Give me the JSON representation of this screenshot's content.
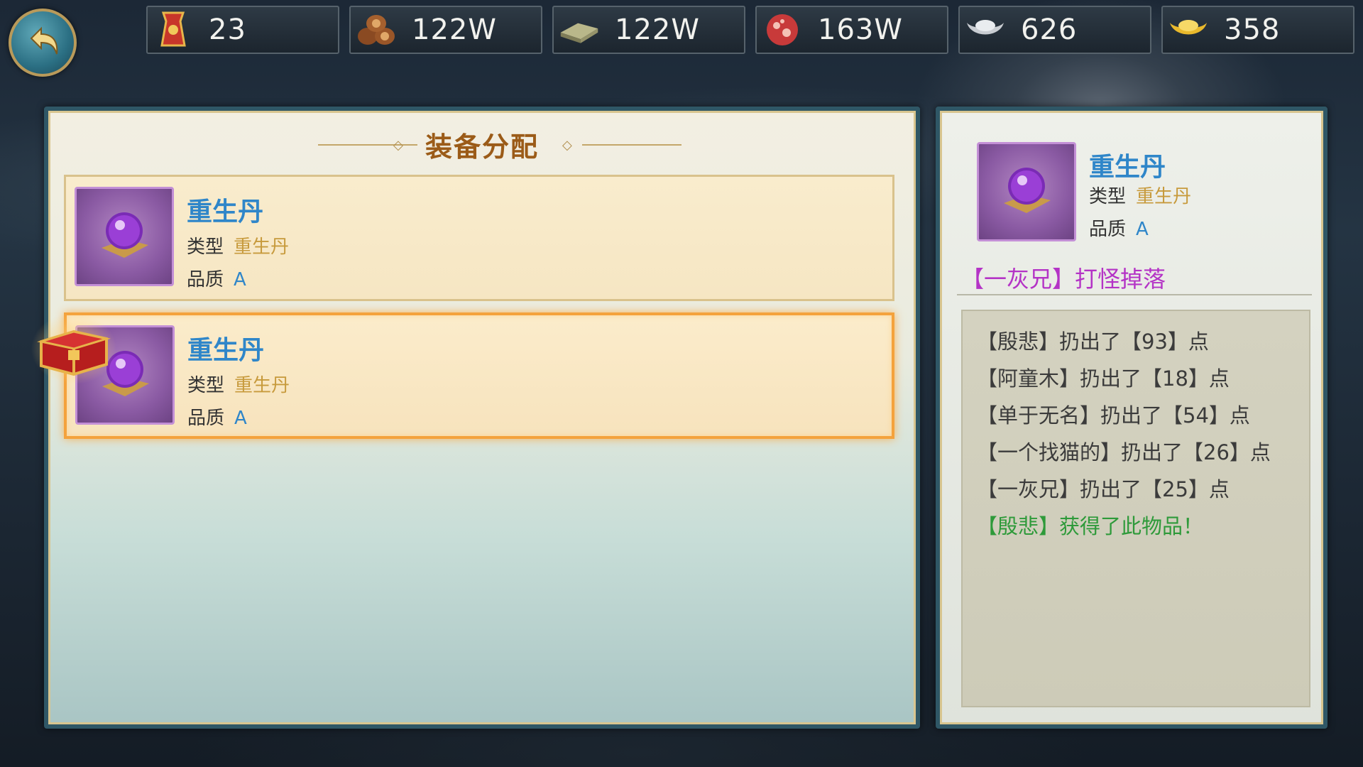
{
  "resources": [
    {
      "icon": "token-icon",
      "value": "23"
    },
    {
      "icon": "wood-icon",
      "value": "122W"
    },
    {
      "icon": "stone-icon",
      "value": "122W"
    },
    {
      "icon": "meat-icon",
      "value": "163W"
    },
    {
      "icon": "silver-icon",
      "value": "626"
    },
    {
      "icon": "gold-icon",
      "value": "358"
    }
  ],
  "panel": {
    "title": "装备分配",
    "items": [
      {
        "name": "重生丹",
        "type_label": "类型",
        "type_value": "重生丹",
        "quality_label": "品质",
        "quality_value": "A",
        "selected": false
      },
      {
        "name": "重生丹",
        "type_label": "类型",
        "type_value": "重生丹",
        "quality_label": "品质",
        "quality_value": "A",
        "selected": true
      }
    ]
  },
  "detail": {
    "name": "重生丹",
    "type_label": "类型",
    "type_value": "重生丹",
    "quality_label": "品质",
    "quality_value": "A",
    "source": "【一灰兄】打怪掉落",
    "log": [
      "【殷悲】扔出了【93】点",
      "【阿童木】扔出了【18】点",
      "【单于无名】扔出了【54】点",
      "【一个找猫的】扔出了【26】点",
      "【一灰兄】扔出了【25】点",
      "【殷悲】获得了此物品！"
    ]
  },
  "colors": {
    "accent_blue": "#2f86c9",
    "type_gold": "#c79a3c",
    "title_brown": "#9b5b18",
    "source_purple": "#b433c6",
    "win_green": "#2e9a3a"
  }
}
